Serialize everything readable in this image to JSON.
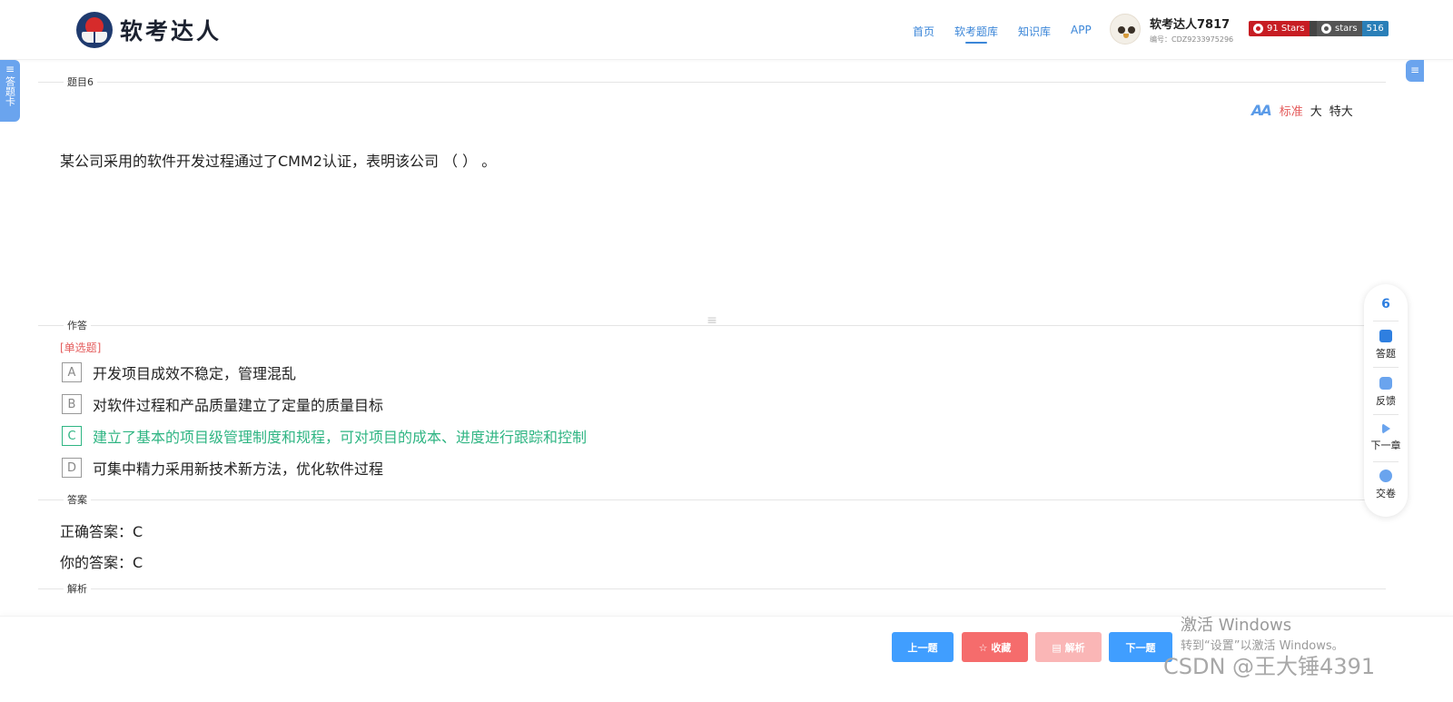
{
  "header": {
    "logo_text": "软考达人",
    "nav": [
      {
        "label": "首页",
        "active": false
      },
      {
        "label": "软考题库",
        "active": true
      },
      {
        "label": "知识库",
        "active": false
      },
      {
        "label": "APP",
        "active": false
      }
    ],
    "user": {
      "name": "软考达人7817",
      "id": "编号：CDZ9233975296"
    },
    "badges": [
      {
        "left": "91 Stars",
        "right": ""
      },
      {
        "left": "stars",
        "right": "516"
      }
    ]
  },
  "sidebar": {
    "left_tab": "答题卡"
  },
  "question": {
    "section_label": "题目6",
    "font_sizes": [
      "标准",
      "大",
      "特大"
    ],
    "font_size_active": "标准",
    "text": "某公司采用的软件开发过程通过了CMM2认证，表明该公司 （ ） 。"
  },
  "answer_section": {
    "section_label": "作答",
    "type": "[单选题]",
    "options": [
      {
        "letter": "A",
        "text": "开发项目成效不稳定，管理混乱",
        "correct": false
      },
      {
        "letter": "B",
        "text": "对软件过程和产品质量建立了定量的质量目标",
        "correct": false
      },
      {
        "letter": "C",
        "text": "建立了基本的项目级管理制度和规程，可对项目的成本、进度进行跟踪和控制",
        "correct": true
      },
      {
        "letter": "D",
        "text": "可集中精力采用新技术新方法，优化软件过程",
        "correct": false
      }
    ]
  },
  "result": {
    "section_label": "答案",
    "correct_answer": "正确答案：C",
    "your_answer": "你的答案：C"
  },
  "analysis": {
    "section_label": "解析"
  },
  "float_panel": {
    "number": "6",
    "items": [
      "答题",
      "反馈",
      "下一章",
      "交卷"
    ]
  },
  "footer": {
    "prev": "上一题",
    "favorite": "☆ 收藏",
    "analysis": "▤ 解析",
    "next": "下一题"
  },
  "watermark": {
    "title": "激活 Windows",
    "subtitle": "转到“设置”以激活 Windows。",
    "csdn": "CSDN @王大锤4391"
  },
  "colors": {
    "primary": "#409eff",
    "danger": "#f56c6c",
    "correct": "#2fb583",
    "accent_red": "#e45b5b"
  }
}
